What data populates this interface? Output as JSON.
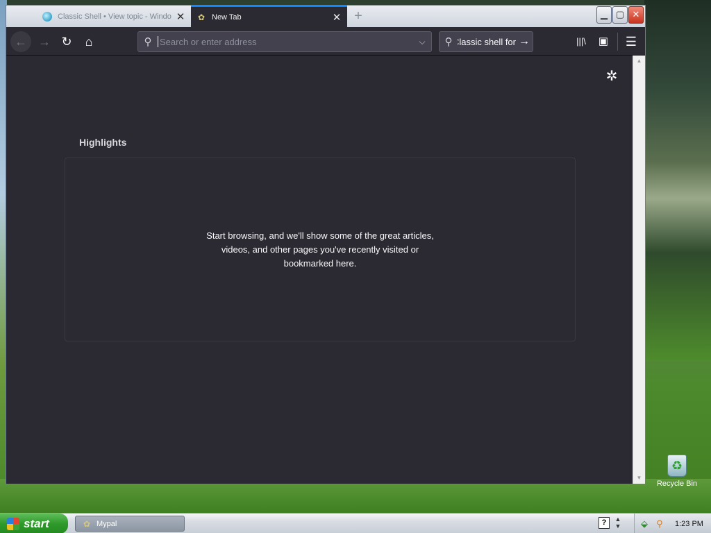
{
  "browser": {
    "tabs": [
      {
        "title": "Classic Shell • View topic - Windo",
        "active": false,
        "favicon": "globe-icon"
      },
      {
        "title": "New Tab",
        "active": true,
        "favicon": "palm-icon"
      }
    ],
    "new_tab_glyph": "+",
    "close_glyph": "✕",
    "window_controls": {
      "minimize": "▁",
      "maximize": "▢",
      "close": "✕"
    }
  },
  "toolbar": {
    "back_glyph": "←",
    "forward_glyph": "→",
    "reload_glyph": "↻",
    "home_glyph": "⌂",
    "url_placeholder": "Search or enter address",
    "url_value": "",
    "search_text": "Classic shell for",
    "search_go_glyph": "→",
    "library_glyph": "|||\\",
    "sidebar_glyph": "▣",
    "menu_glyph": "☰"
  },
  "content": {
    "settings_glyph": "✲",
    "highlights_title": "Highlights",
    "highlights_empty": "Start browsing, and we'll show some of the great articles, videos, and other pages you've recently visited or bookmarked here."
  },
  "desktop": {
    "recycle_bin_label": "Recycle Bin"
  },
  "taskbar": {
    "start_label": "start",
    "items": [
      {
        "label": "Mypal",
        "icon": "palm-icon"
      }
    ],
    "help_glyph": "?",
    "clock": "1:23 PM"
  },
  "colors": {
    "content_bg": "#2b2a33",
    "toolbar_field_bg": "#42414d",
    "active_tab_accent": "#0a84ff",
    "start_button": "#2f9a2b"
  }
}
